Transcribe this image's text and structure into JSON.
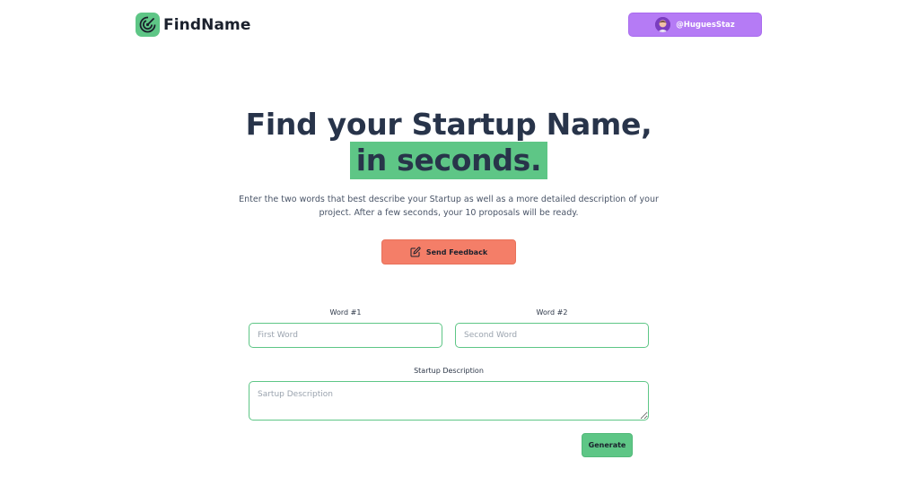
{
  "header": {
    "brand_name": "FindName",
    "user_handle": "@HuguesStaz"
  },
  "hero": {
    "title_line1": "Find your Startup Name,",
    "title_line2": "in seconds.",
    "description": "Enter the two words that best describe your Startup as well as a more detailed description of your project. After a few seconds, your 10 proposals will be ready.",
    "feedback_label": "Send Feedback"
  },
  "form": {
    "word1": {
      "label": "Word #1",
      "placeholder": "First Word",
      "value": ""
    },
    "word2": {
      "label": "Word #2",
      "placeholder": "Second Word",
      "value": ""
    },
    "description": {
      "label": "Startup Description",
      "placeholder": "Sartup Description",
      "value": ""
    },
    "generate_label": "Generate"
  },
  "colors": {
    "accent_green": "#5ec686",
    "user_button_purple": "#b57bf5",
    "feedback_coral": "#f47e68",
    "title_text": "#28344a"
  },
  "icons": {
    "brand": "radar-target-icon",
    "feedback": "pencil-square-icon",
    "avatar": "user-avatar-icon"
  }
}
